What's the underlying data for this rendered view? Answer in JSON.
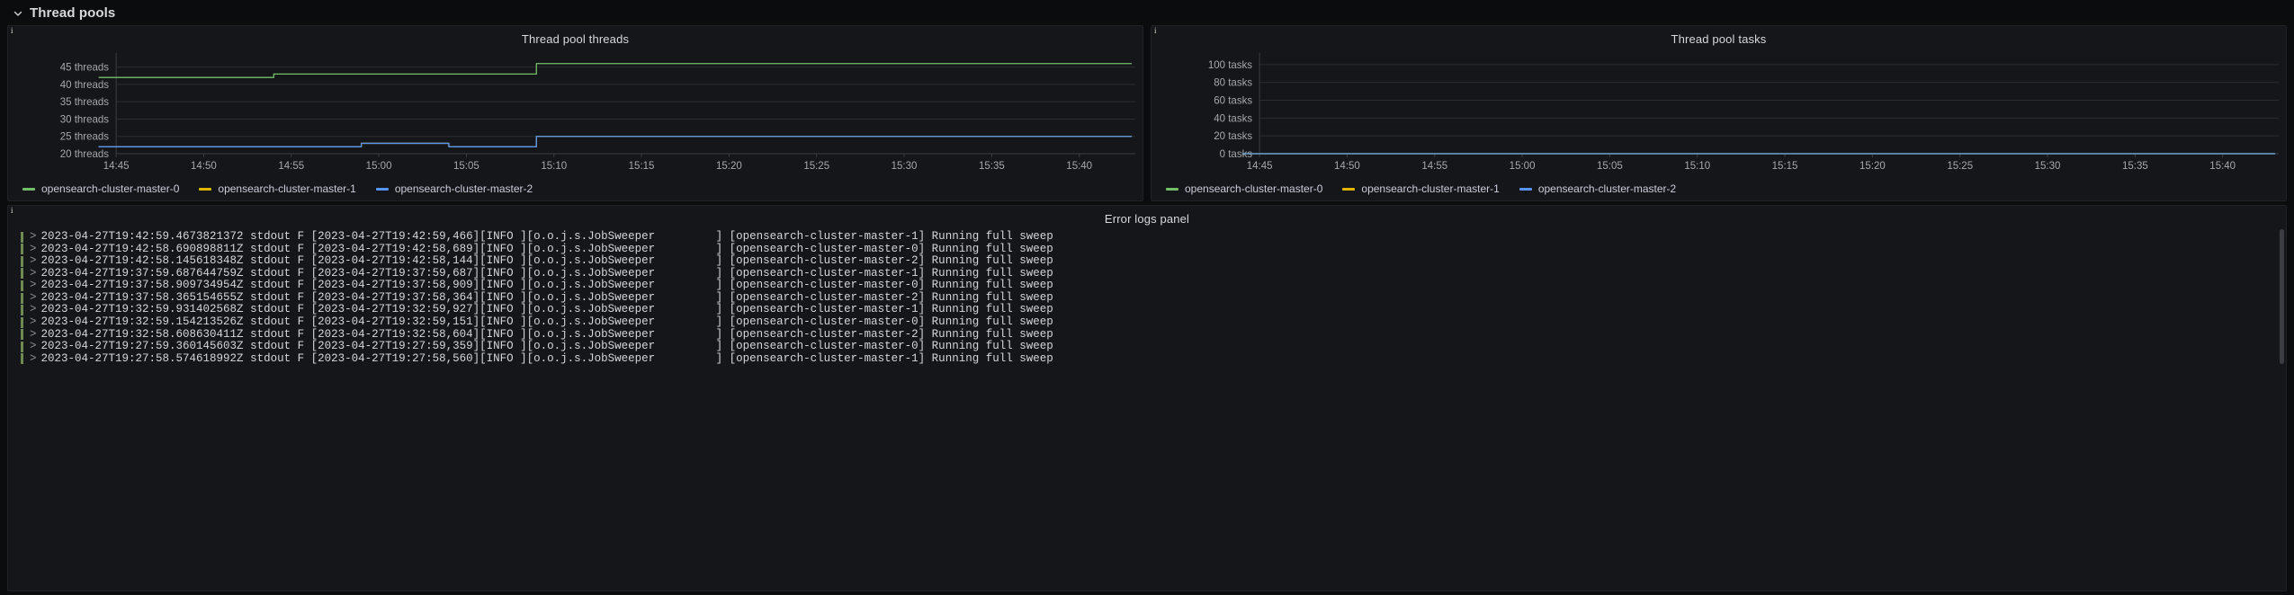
{
  "row": {
    "title": "Thread pools",
    "chevron_icon": "chevron-down-icon",
    "expanded": true
  },
  "panels": [
    {
      "title": "Thread pool threads",
      "corner_mark": "i",
      "corner_icon": "panel-info-corner-icon",
      "legend": [
        {
          "label": "opensearch-cluster-master-0",
          "color": "#73bf69"
        },
        {
          "label": "opensearch-cluster-master-1",
          "color": "#e0b400"
        },
        {
          "label": "opensearch-cluster-master-2",
          "color": "#5794f2"
        }
      ]
    },
    {
      "title": "Thread pool tasks",
      "corner_mark": "i",
      "corner_icon": "panel-info-corner-icon",
      "legend": [
        {
          "label": "opensearch-cluster-master-0",
          "color": "#73bf69"
        },
        {
          "label": "opensearch-cluster-master-1",
          "color": "#e0b400"
        },
        {
          "label": "opensearch-cluster-master-2",
          "color": "#5794f2"
        }
      ]
    }
  ],
  "logs_panel": {
    "title": "Error logs panel",
    "corner_mark": "i",
    "corner_icon": "panel-info-corner-icon",
    "expand_icon": "chevron-right-icon",
    "rows": [
      {
        "ts": "2023-04-27T19:42:59.4673821372",
        "body": "stdout F [2023-04-27T19:42:59,466][INFO ][o.o.j.s.JobSweeper         ] [opensearch-cluster-master-1] Running full sweep"
      },
      {
        "ts": "2023-04-27T19:42:58.690898811Z",
        "body": "stdout F [2023-04-27T19:42:58,689][INFO ][o.o.j.s.JobSweeper         ] [opensearch-cluster-master-0] Running full sweep"
      },
      {
        "ts": "2023-04-27T19:42:58.145618348Z",
        "body": "stdout F [2023-04-27T19:42:58,144][INFO ][o.o.j.s.JobSweeper         ] [opensearch-cluster-master-2] Running full sweep"
      },
      {
        "ts": "2023-04-27T19:37:59.687644759Z",
        "body": "stdout F [2023-04-27T19:37:59,687][INFO ][o.o.j.s.JobSweeper         ] [opensearch-cluster-master-1] Running full sweep"
      },
      {
        "ts": "2023-04-27T19:37:58.909734954Z",
        "body": "stdout F [2023-04-27T19:37:58,909][INFO ][o.o.j.s.JobSweeper         ] [opensearch-cluster-master-0] Running full sweep"
      },
      {
        "ts": "2023-04-27T19:37:58.365154655Z",
        "body": "stdout F [2023-04-27T19:37:58,364][INFO ][o.o.j.s.JobSweeper         ] [opensearch-cluster-master-2] Running full sweep"
      },
      {
        "ts": "2023-04-27T19:32:59.931402568Z",
        "body": "stdout F [2023-04-27T19:32:59,927][INFO ][o.o.j.s.JobSweeper         ] [opensearch-cluster-master-1] Running full sweep"
      },
      {
        "ts": "2023-04-27T19:32:59.154213526Z",
        "body": "stdout F [2023-04-27T19:32:59,151][INFO ][o.o.j.s.JobSweeper         ] [opensearch-cluster-master-0] Running full sweep"
      },
      {
        "ts": "2023-04-27T19:32:58.608630411Z",
        "body": "stdout F [2023-04-27T19:32:58,604][INFO ][o.o.j.s.JobSweeper         ] [opensearch-cluster-master-2] Running full sweep"
      },
      {
        "ts": "2023-04-27T19:27:59.360145603Z",
        "body": "stdout F [2023-04-27T19:27:59,359][INFO ][o.o.j.s.JobSweeper         ] [opensearch-cluster-master-0] Running full sweep"
      },
      {
        "ts": "2023-04-27T19:27:58.574618992Z",
        "body": "stdout F [2023-04-27T19:27:58,560][INFO ][o.o.j.s.JobSweeper         ] [opensearch-cluster-master-1] Running full sweep"
      }
    ]
  },
  "chart_data": [
    {
      "type": "line",
      "title": "Thread pool threads",
      "xlabel": "",
      "ylabel": "",
      "unit": "threads",
      "ylim": [
        20,
        47.5
      ],
      "yticks": [
        20,
        25,
        30,
        35,
        40,
        45
      ],
      "ytick_labels": [
        "20 threads",
        "25 threads",
        "30 threads",
        "35 threads",
        "40 threads",
        "45 threads"
      ],
      "x": [
        "14:45",
        "14:50",
        "14:55",
        "15:00",
        "15:05",
        "15:10",
        "15:15",
        "15:20",
        "15:25",
        "15:30",
        "15:35",
        "15:40"
      ],
      "xlim_minutes": [
        14.75,
        15.72
      ],
      "grid": true,
      "legend_position": "bottom",
      "series": [
        {
          "name": "opensearch-cluster-master-0",
          "color": "#73bf69",
          "points": [
            {
              "t": "14:44",
              "v": 42
            },
            {
              "t": "14:53",
              "v": 42
            },
            {
              "t": "14:54",
              "v": 43
            },
            {
              "t": "15:08",
              "v": 43
            },
            {
              "t": "15:09",
              "v": 46
            },
            {
              "t": "15:43",
              "v": 46
            }
          ]
        },
        {
          "name": "opensearch-cluster-master-1",
          "color": "#e0b400",
          "points": [
            {
              "t": "14:44",
              "v": 22
            },
            {
              "t": "14:58",
              "v": 22
            },
            {
              "t": "14:59",
              "v": 23
            },
            {
              "t": "15:03",
              "v": 23
            },
            {
              "t": "15:04",
              "v": 22
            },
            {
              "t": "15:08",
              "v": 22
            },
            {
              "t": "15:09",
              "v": 25
            },
            {
              "t": "15:43",
              "v": 25
            }
          ]
        },
        {
          "name": "opensearch-cluster-master-2",
          "color": "#5794f2",
          "points": [
            {
              "t": "14:44",
              "v": 22
            },
            {
              "t": "14:58",
              "v": 22
            },
            {
              "t": "14:59",
              "v": 23
            },
            {
              "t": "15:03",
              "v": 23
            },
            {
              "t": "15:04",
              "v": 22
            },
            {
              "t": "15:08",
              "v": 22
            },
            {
              "t": "15:09",
              "v": 25
            },
            {
              "t": "15:43",
              "v": 25
            }
          ]
        }
      ]
    },
    {
      "type": "line",
      "title": "Thread pool tasks",
      "xlabel": "",
      "ylabel": "",
      "unit": "tasks",
      "ylim": [
        0,
        107
      ],
      "yticks": [
        0,
        20,
        40,
        60,
        80,
        100
      ],
      "ytick_labels": [
        "0 tasks",
        "20 tasks",
        "40 tasks",
        "60 tasks",
        "80 tasks",
        "100 tasks"
      ],
      "x": [
        "14:45",
        "14:50",
        "14:55",
        "15:00",
        "15:05",
        "15:10",
        "15:15",
        "15:20",
        "15:25",
        "15:30",
        "15:35",
        "15:40"
      ],
      "xlim_minutes": [
        14.75,
        15.72
      ],
      "grid": true,
      "legend_position": "bottom",
      "series": [
        {
          "name": "opensearch-cluster-master-0",
          "color": "#73bf69",
          "points": [
            {
              "t": "14:44",
              "v": 0
            },
            {
              "t": "15:43",
              "v": 0
            }
          ]
        },
        {
          "name": "opensearch-cluster-master-1",
          "color": "#e0b400",
          "points": [
            {
              "t": "14:44",
              "v": 0
            },
            {
              "t": "15:43",
              "v": 0
            }
          ]
        },
        {
          "name": "opensearch-cluster-master-2",
          "color": "#5794f2",
          "points": [
            {
              "t": "14:44",
              "v": 0
            },
            {
              "t": "15:43",
              "v": 0
            }
          ]
        }
      ]
    }
  ]
}
